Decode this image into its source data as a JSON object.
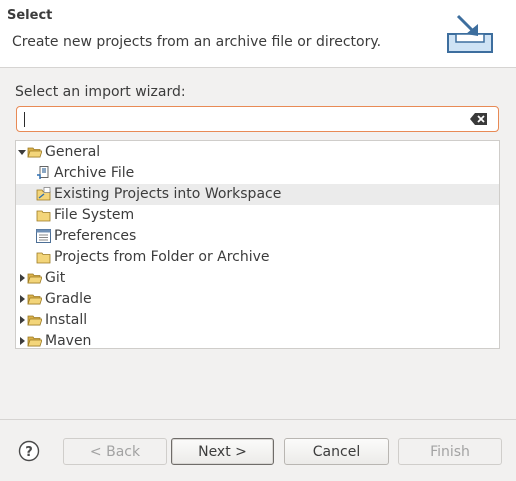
{
  "header": {
    "title": "Select",
    "description": "Create new projects from an archive file or directory.",
    "icon": "import-wizard-icon"
  },
  "prompt": "Select an import wizard:",
  "filter": {
    "value": "",
    "placeholder": ""
  },
  "tree": {
    "items": [
      {
        "label": "General",
        "expanded": true,
        "icon": "folder-open-icon"
      },
      {
        "label": "Archive File",
        "icon": "archive-file-icon"
      },
      {
        "label": "Existing Projects into Workspace",
        "icon": "existing-projects-icon",
        "selected": true
      },
      {
        "label": "File System",
        "icon": "folder-icon"
      },
      {
        "label": "Preferences",
        "icon": "preferences-icon"
      },
      {
        "label": "Projects from Folder or Archive",
        "icon": "folder-icon"
      },
      {
        "label": "Git",
        "expanded": false,
        "icon": "folder-icon"
      },
      {
        "label": "Gradle",
        "expanded": false,
        "icon": "folder-icon"
      },
      {
        "label": "Install",
        "expanded": false,
        "icon": "folder-icon"
      },
      {
        "label": "Maven",
        "expanded": false,
        "icon": "folder-icon"
      }
    ]
  },
  "buttons": {
    "help": "?",
    "back": "< Back",
    "next": "Next >",
    "cancel": "Cancel",
    "finish": "Finish"
  },
  "colors": {
    "accent_border": "#e88a55",
    "selection": "#ebebeb",
    "folder": "#e9c46a"
  }
}
